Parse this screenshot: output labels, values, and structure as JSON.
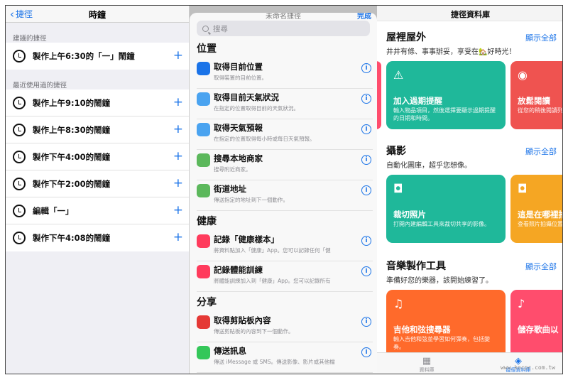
{
  "panel1": {
    "back_label": "捷徑",
    "title": "時鐘",
    "section_suggested": "建議的捷徑",
    "suggested": [
      "製作上午6:30的「一」鬧鐘"
    ],
    "section_recent": "最近使用過的捷徑",
    "recent": [
      "製作上午9:10的鬧鐘",
      "製作上午8:30的鬧鐘",
      "製作下午4:00的鬧鐘",
      "製作下午2:00的鬧鐘",
      "編輯「一」",
      "製作下午4:08的鬧鐘"
    ]
  },
  "panel2": {
    "sheet_title": "未命名捷徑",
    "done_label": "完成",
    "search_placeholder": "搜尋",
    "groups": [
      {
        "name": "位置",
        "items": [
          {
            "title": "取得目前位置",
            "sub": "取得裝置的目前位置。",
            "color": "#1a73e8",
            "icon": "location-arrow-icon"
          },
          {
            "title": "取得目前天氣狀況",
            "sub": "在指定的位置取得目前的天氣狀況。",
            "color": "#4aa3f0",
            "icon": "weather-icon"
          },
          {
            "title": "取得天氣預報",
            "sub": "在指定的位置取得每小時或每日天氣預報。",
            "color": "#4aa3f0",
            "icon": "weather-icon"
          },
          {
            "title": "搜尋本地商家",
            "sub": "搜尋附近商家。",
            "color": "#5cb85c",
            "icon": "maps-icon"
          },
          {
            "title": "街道地址",
            "sub": "傳送指定的地址到下一個動作。",
            "color": "#5cb85c",
            "icon": "maps-icon"
          }
        ]
      },
      {
        "name": "健康",
        "items": [
          {
            "title": "記錄「健康樣本」",
            "sub": "將資料點加入「健康」App。您可以記錄任何「健",
            "color": "#ff3b5c",
            "icon": "health-heart-icon"
          },
          {
            "title": "記錄體能訓練",
            "sub": "將體能訓練加入到「健康」App。您可以記錄所有",
            "color": "#ff3b5c",
            "icon": "health-heart-icon"
          }
        ]
      },
      {
        "name": "分享",
        "items": [
          {
            "title": "取得剪貼板內容",
            "sub": "傳送剪貼板的內容到下一個動作。",
            "color": "#e53935",
            "icon": "clipboard-icon"
          },
          {
            "title": "傳送訊息",
            "sub": "傳送 iMessage 或 SMS。傳送影像、影片或其他檔",
            "color": "#34c759",
            "icon": "messages-icon"
          }
        ]
      }
    ]
  },
  "panel3": {
    "top_title": "捷徑資料庫",
    "show_all": "顯示全部",
    "sections": [
      {
        "title": "屋裡屋外",
        "sub": "井井有條、事事辦妥，享受在🏡好時光！",
        "cards": [
          {
            "icon": "⚠",
            "icon_name": "warning-icon",
            "title": "加入過期提醒",
            "desc": "輸入物品項目，然後選擇要顯示過期提醒的日期和時間。",
            "color": "#1fb89a"
          },
          {
            "icon": "◉",
            "icon_name": "rss-icon",
            "title": "放鬆閱讀",
            "desc": "從您的稍後閱讀列表中隨機選取文章",
            "color": "#ef5350"
          }
        ]
      },
      {
        "title": "攝影",
        "sub": "自動化圖庫，超乎您想像。",
        "cards": [
          {
            "icon": "◘",
            "icon_name": "camera-icon",
            "title": "裁切照片",
            "desc": "打開內建編輯工具來裁切共享的影像。",
            "color": "#1fb89a"
          },
          {
            "icon": "◘",
            "icon_name": "camera-icon",
            "title": "這是在哪裡拍",
            "desc": "查看照片拍攝位置",
            "color": "#f5a623"
          }
        ]
      },
      {
        "title": "音樂製作工具",
        "sub": "準備好您的樂器，該開始練習了。",
        "cards": [
          {
            "icon": "♫",
            "icon_name": "music-note-icon",
            "title": "吉他和弦搜尋器",
            "desc": "輸入吉他和弦並學習如何彈奏，包括變奏。",
            "color": "#ff6a2b"
          },
          {
            "icon": "♪",
            "icon_name": "headphones-icon",
            "title": "儲存歌曲以",
            "desc": "",
            "color": "#ff4d6d"
          }
        ]
      }
    ],
    "tabs": [
      {
        "label": "資料庫",
        "glyph": "▦"
      },
      {
        "label": "捷徑資料庫",
        "glyph": "◈"
      }
    ],
    "watermark": "www.kocpc.com.tw"
  }
}
